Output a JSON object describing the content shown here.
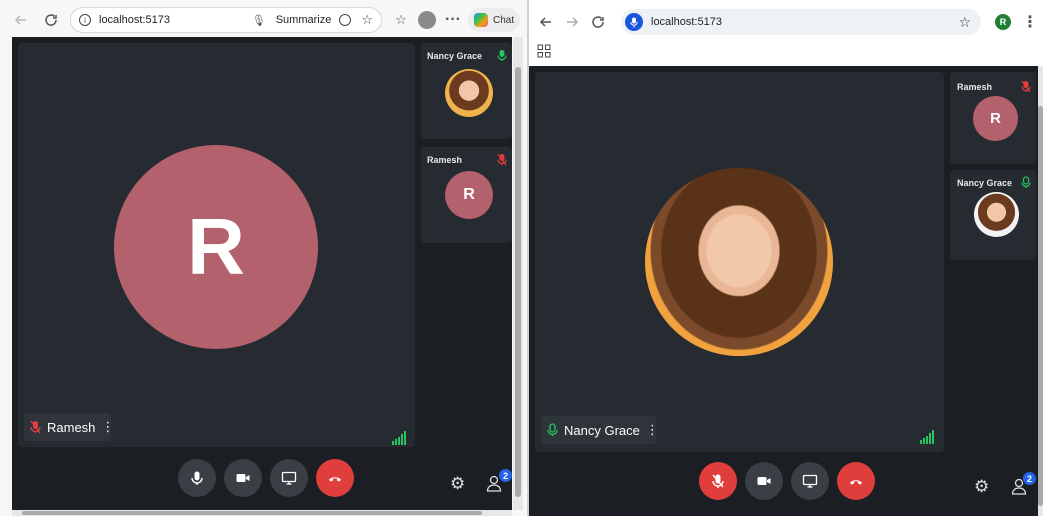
{
  "left_browser": {
    "address": "localhost:5173",
    "summarize_label": "Summarize",
    "chat_label": "Chat"
  },
  "right_browser": {
    "address": "localhost:5173",
    "profile_initial": "R"
  },
  "left_meeting": {
    "main_participant": {
      "name": "Ramesh",
      "initial": "R",
      "muted": true
    },
    "side_participants": [
      {
        "name": "Nancy Grace",
        "mic": "on"
      },
      {
        "name": "Ramesh",
        "initial": "R",
        "mic": "muted"
      }
    ],
    "participants_count": "2"
  },
  "right_meeting": {
    "main_participant": {
      "name": "Nancy Grace",
      "muted": false
    },
    "side_participants": [
      {
        "name": "Ramesh",
        "initial": "R",
        "mic": "muted"
      },
      {
        "name": "Nancy Grace",
        "mic": "on"
      }
    ],
    "participants_count": "2"
  },
  "colors": {
    "avatar_bg": "#b3616c",
    "meeting_bg": "#1b1f24",
    "tile_bg": "#262b31",
    "mic_on": "#22c55e",
    "mic_muted": "#e03d3d",
    "end_call": "#e03d3d",
    "badge": "#2563eb"
  }
}
